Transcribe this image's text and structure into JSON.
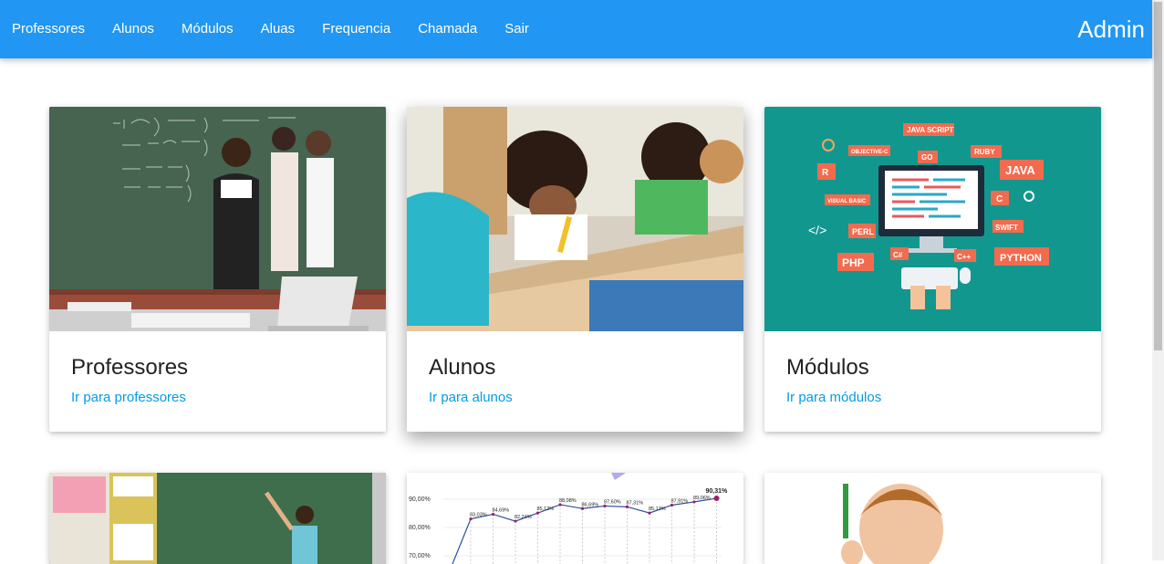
{
  "nav": {
    "links": [
      "Professores",
      "Alunos",
      "Módulos",
      "Aluas",
      "Frequencia",
      "Chamada",
      "Sair"
    ],
    "brand": "Admin"
  },
  "cards": [
    {
      "title": "Professores",
      "link": "Ir para professores",
      "image": "teachers-at-chalkboard-photo"
    },
    {
      "title": "Alunos",
      "link": "Ir para alunos",
      "image": "students-writing-photo"
    },
    {
      "title": "Módulos",
      "link": "Ir para módulos",
      "image": "programming-languages-illustration"
    },
    {
      "image": "teacher-pointing-at-board-photo"
    },
    {
      "image": "percentage-line-chart-image"
    },
    {
      "image": "boy-raising-pencil-photo"
    }
  ],
  "chart_thumb": {
    "y_ticks": [
      "90,00%",
      "80,00%",
      "70,00%"
    ],
    "points": [
      {
        "label": "83,03%",
        "value": 83.03
      },
      {
        "label": "84,69%",
        "value": 84.69
      },
      {
        "label": "82,24%",
        "value": 82.24
      },
      {
        "label": "85,12%",
        "value": 85.12
      },
      {
        "label": "88,08%",
        "value": 88.08
      },
      {
        "label": "86,69%",
        "value": 86.69
      },
      {
        "label": "87,60%",
        "value": 87.6
      },
      {
        "label": "87,31%",
        "value": 87.31
      },
      {
        "label": "85,13%",
        "value": 85.13
      },
      {
        "label": "87,91%",
        "value": 87.91
      },
      {
        "label": "89,06%",
        "value": 89.06
      },
      {
        "label": "90,31%",
        "value": 90.31
      }
    ]
  },
  "module_icons": [
    "JAVA SCRIPT",
    "OBJECTIVE-C",
    "GO",
    "RUBY",
    "R",
    "JAVA",
    "VISUAL BASIC",
    "C",
    "PERL",
    "SWIFT",
    "PHP",
    "C#",
    "C++",
    "PYTHON"
  ]
}
